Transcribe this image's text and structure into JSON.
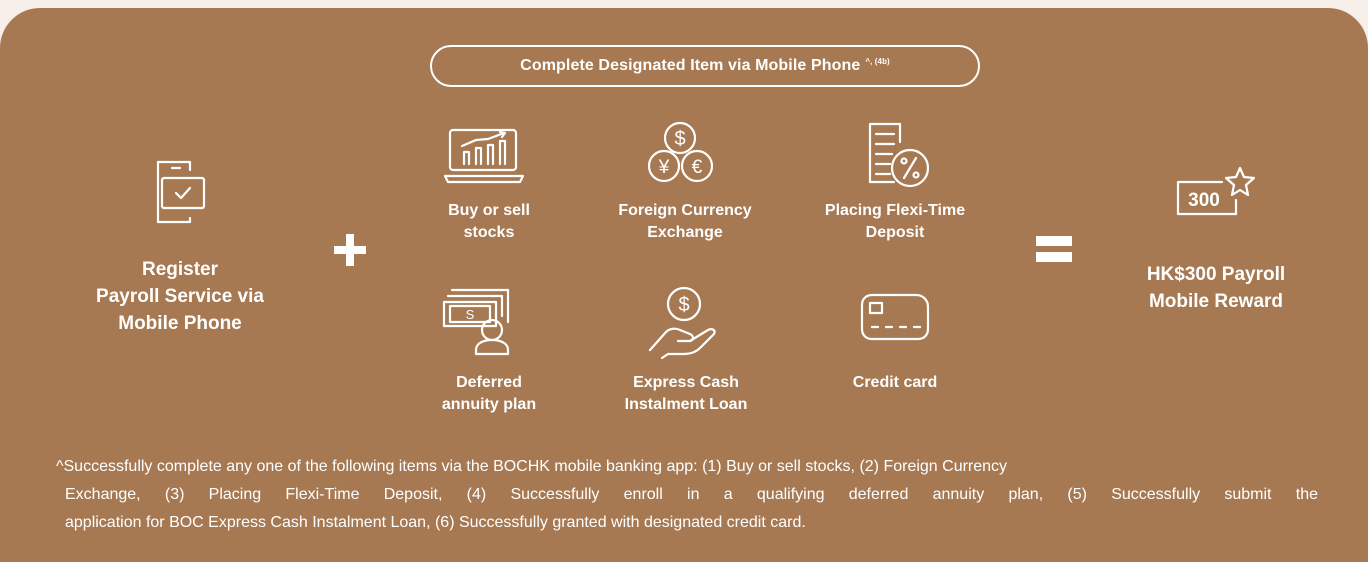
{
  "header": {
    "title": "Complete Designated Item via Mobile Phone",
    "title_sup": "^, (4b)"
  },
  "left": {
    "label_lines": [
      "Register",
      "Payroll Service via",
      "Mobile Phone"
    ]
  },
  "operators": {
    "plus": "+",
    "equals": "="
  },
  "items": [
    {
      "lines": [
        "Buy or sell",
        "stocks"
      ],
      "icon": "laptop-chart-icon"
    },
    {
      "lines": [
        "Foreign Currency",
        "Exchange"
      ],
      "icon": "currency-exchange-icon"
    },
    {
      "lines": [
        "Placing Flexi-Time",
        "Deposit"
      ],
      "icon": "deposit-percent-icon"
    },
    {
      "lines": [
        "Deferred",
        "annuity plan"
      ],
      "icon": "annuity-person-icon"
    },
    {
      "lines": [
        "Express Cash",
        "Instalment Loan"
      ],
      "icon": "hand-dollar-icon"
    },
    {
      "lines": [
        "Credit card"
      ],
      "icon": "credit-card-icon"
    }
  ],
  "reward": {
    "badge": "300",
    "label_lines": [
      "HK$300 Payroll",
      "Mobile Reward"
    ]
  },
  "footnote": {
    "lines": [
      "^Successfully complete any one of the following items via the BOCHK mobile banking app: (1) Buy or sell stocks, (2) Foreign Currency",
      "Exchange, (3) Placing Flexi-Time Deposit, (4) Successfully enroll in a qualifying deferred annuity plan, (5) Successfully submit the",
      "application for BOC Express Cash Instalment Loan, (6) Successfully granted with designated credit card."
    ]
  },
  "colors": {
    "panel": "#a67953",
    "background": "#f6eee8",
    "text": "#ffffff"
  }
}
